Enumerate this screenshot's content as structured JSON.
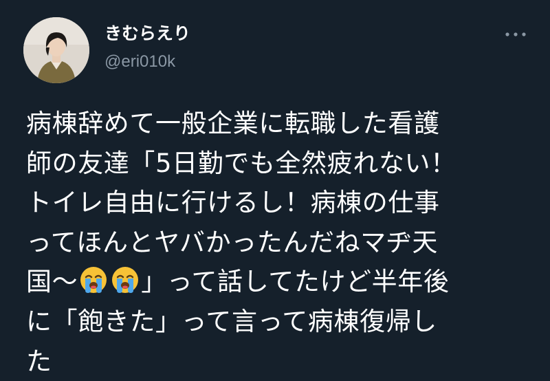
{
  "author": {
    "display_name": "きむらえり",
    "handle": "@eri010k"
  },
  "actions": {
    "more_icon": "more-horizontal-icon"
  },
  "tweet": {
    "line1": "病棟辞めて一般企業に転職した看護",
    "line2": "師の友達「5日勤でも全然疲れない！",
    "line3": "トイレ自由に行けるし！病棟の仕事",
    "line4": "ってほんとヤバかったんだねマヂ天",
    "line5_before": "国〜",
    "line5_after": "」って話してたけど半年後",
    "line6": "に「飽きた」って言って病棟復帰し",
    "line7": "た",
    "emoji_names": [
      "loudly-crying-face-icon",
      "loudly-crying-face-icon"
    ]
  },
  "colors": {
    "background": "#15202b",
    "text_primary": "#ffffff",
    "text_secondary": "#8b98a5",
    "emoji_face": "#f7c237",
    "emoji_tears": "#4fa8ec"
  }
}
